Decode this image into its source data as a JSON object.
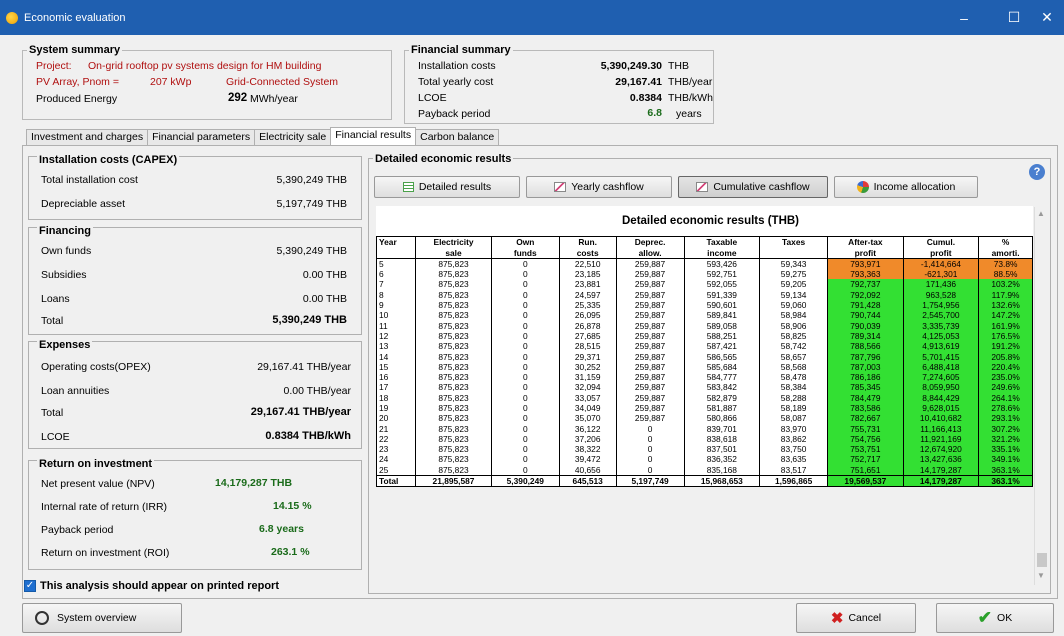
{
  "window": {
    "title": "Economic evaluation",
    "minimize": "–",
    "maximize": "☐",
    "close": "✕",
    "brand_color": "#1f5fb0"
  },
  "system_summary": {
    "legend": "System summary",
    "project_label": "Project:",
    "project_value": "On-grid rooftop pv systems design for HM building",
    "pv_label": "PV Array, Pnom =",
    "pv_value": "207 kWp",
    "grid": "Grid-Connected System",
    "energy_label": "Produced Energy",
    "energy_value": "292",
    "energy_unit": "MWh/year"
  },
  "financial_summary": {
    "legend": "Financial summary",
    "inst_label": "Installation costs",
    "inst_value": "5,390,249.30",
    "inst_unit": "THB",
    "yearly_label": "Total yearly cost",
    "yearly_value": "29,167.41",
    "yearly_unit": "THB/year",
    "lcoe_label": "LCOE",
    "lcoe_value": "0.8384",
    "lcoe_unit": "THB/kWh",
    "payback_label": "Payback period",
    "payback_value": "6.8",
    "payback_unit": "years"
  },
  "tabs": [
    "Investment and charges",
    "Financial parameters",
    "Electricity sale",
    "Financial results",
    "Carbon balance"
  ],
  "capex": {
    "legend": "Installation costs (CAPEX)",
    "total_label": "Total installation cost",
    "total_value": "5,390,249 THB",
    "dep_label": "Depreciable asset",
    "dep_value": "5,197,749 THB"
  },
  "financing": {
    "legend": "Financing",
    "own_label": "Own funds",
    "own_value": "5,390,249 THB",
    "sub_label": "Subsidies",
    "sub_value": "0.00 THB",
    "loans_label": "Loans",
    "loans_value": "0.00 THB",
    "total_label": "Total",
    "total_value": "5,390,249 THB"
  },
  "expenses": {
    "legend": "Expenses",
    "opex_label": "Operating costs(OPEX)",
    "opex_value": "29,167.41 THB/year",
    "annu_label": "Loan annuities",
    "annu_value": "0.00 THB/year",
    "total_label": "Total",
    "total_value": "29,167.41 THB/year",
    "lcoe_label": "LCOE",
    "lcoe_value": "0.8384 THB/kWh"
  },
  "roi": {
    "legend": "Return on investment",
    "npv_label": "Net present value (NPV)",
    "npv_value": "14,179,287 THB",
    "irr_label": "Internal rate of return (IRR)",
    "irr_value": "14.15 %",
    "pb_label": "Payback period",
    "pb_value": "6.8 years",
    "roi_label": "Return on investment (ROI)",
    "roi_value": "263.1 %"
  },
  "report_check": "This analysis should appear on printed report",
  "detailed": {
    "legend": "Detailed economic results",
    "btn_detailed": "Detailed results",
    "btn_yearly": "Yearly cashflow",
    "btn_cumul": "Cumulative cashflow",
    "btn_income": "Income allocation",
    "table_title": "Detailed economic results (THB)",
    "headers1": [
      "Year",
      "Electricity",
      "Own",
      "Run.",
      "Deprec.",
      "Taxable",
      "Taxes",
      "After-tax",
      "Cumul.",
      "%"
    ],
    "headers2": [
      "",
      "sale",
      "funds",
      "costs",
      "allow.",
      "income",
      "",
      "profit",
      "profit",
      "amorti."
    ],
    "rows": [
      [
        "5",
        "875,823",
        "0",
        "22,510",
        "259,887",
        "593,426",
        "59,343",
        "793,971",
        "-1,414,664",
        "73.8%"
      ],
      [
        "6",
        "875,823",
        "0",
        "23,185",
        "259,887",
        "592,751",
        "59,275",
        "793,363",
        "-621,301",
        "88.5%"
      ],
      [
        "7",
        "875,823",
        "0",
        "23,881",
        "259,887",
        "592,055",
        "59,205",
        "792,737",
        "171,436",
        "103.2%"
      ],
      [
        "8",
        "875,823",
        "0",
        "24,597",
        "259,887",
        "591,339",
        "59,134",
        "792,092",
        "963,528",
        "117.9%"
      ],
      [
        "9",
        "875,823",
        "0",
        "25,335",
        "259,887",
        "590,601",
        "59,060",
        "791,428",
        "1,754,956",
        "132.6%"
      ],
      [
        "10",
        "875,823",
        "0",
        "26,095",
        "259,887",
        "589,841",
        "58,984",
        "790,744",
        "2,545,700",
        "147.2%"
      ],
      [
        "11",
        "875,823",
        "0",
        "26,878",
        "259,887",
        "589,058",
        "58,906",
        "790,039",
        "3,335,739",
        "161.9%"
      ],
      [
        "12",
        "875,823",
        "0",
        "27,685",
        "259,887",
        "588,251",
        "58,825",
        "789,314",
        "4,125,053",
        "176.5%"
      ],
      [
        "13",
        "875,823",
        "0",
        "28,515",
        "259,887",
        "587,421",
        "58,742",
        "788,566",
        "4,913,619",
        "191.2%"
      ],
      [
        "14",
        "875,823",
        "0",
        "29,371",
        "259,887",
        "586,565",
        "58,657",
        "787,796",
        "5,701,415",
        "205.8%"
      ],
      [
        "15",
        "875,823",
        "0",
        "30,252",
        "259,887",
        "585,684",
        "58,568",
        "787,003",
        "6,488,418",
        "220.4%"
      ],
      [
        "16",
        "875,823",
        "0",
        "31,159",
        "259,887",
        "584,777",
        "58,478",
        "786,186",
        "7,274,605",
        "235.0%"
      ],
      [
        "17",
        "875,823",
        "0",
        "32,094",
        "259,887",
        "583,842",
        "58,384",
        "785,345",
        "8,059,950",
        "249.6%"
      ],
      [
        "18",
        "875,823",
        "0",
        "33,057",
        "259,887",
        "582,879",
        "58,288",
        "784,479",
        "8,844,429",
        "264.1%"
      ],
      [
        "19",
        "875,823",
        "0",
        "34,049",
        "259,887",
        "581,887",
        "58,189",
        "783,586",
        "9,628,015",
        "278.6%"
      ],
      [
        "20",
        "875,823",
        "0",
        "35,070",
        "259,887",
        "580,866",
        "58,087",
        "782,667",
        "10,410,682",
        "293.1%"
      ],
      [
        "21",
        "875,823",
        "0",
        "36,122",
        "0",
        "839,701",
        "83,970",
        "755,731",
        "11,166,413",
        "307.2%"
      ],
      [
        "22",
        "875,823",
        "0",
        "37,206",
        "0",
        "838,618",
        "83,862",
        "754,756",
        "11,921,169",
        "321.2%"
      ],
      [
        "23",
        "875,823",
        "0",
        "38,322",
        "0",
        "837,501",
        "83,750",
        "753,751",
        "12,674,920",
        "335.1%"
      ],
      [
        "24",
        "875,823",
        "0",
        "39,472",
        "0",
        "836,352",
        "83,635",
        "752,717",
        "13,427,636",
        "349.1%"
      ],
      [
        "25",
        "875,823",
        "0",
        "40,656",
        "0",
        "835,168",
        "83,517",
        "751,651",
        "14,179,287",
        "363.1%"
      ]
    ],
    "total": [
      "Total",
      "21,895,587",
      "5,390,249",
      "645,513",
      "5,197,749",
      "15,968,653",
      "1,596,865",
      "19,569,537",
      "14,179,287",
      "363.1%"
    ],
    "green": "#33e033",
    "orange": "#f08a2a"
  },
  "footer": {
    "overview": "System overview",
    "cancel": "Cancel",
    "ok": "OK"
  }
}
